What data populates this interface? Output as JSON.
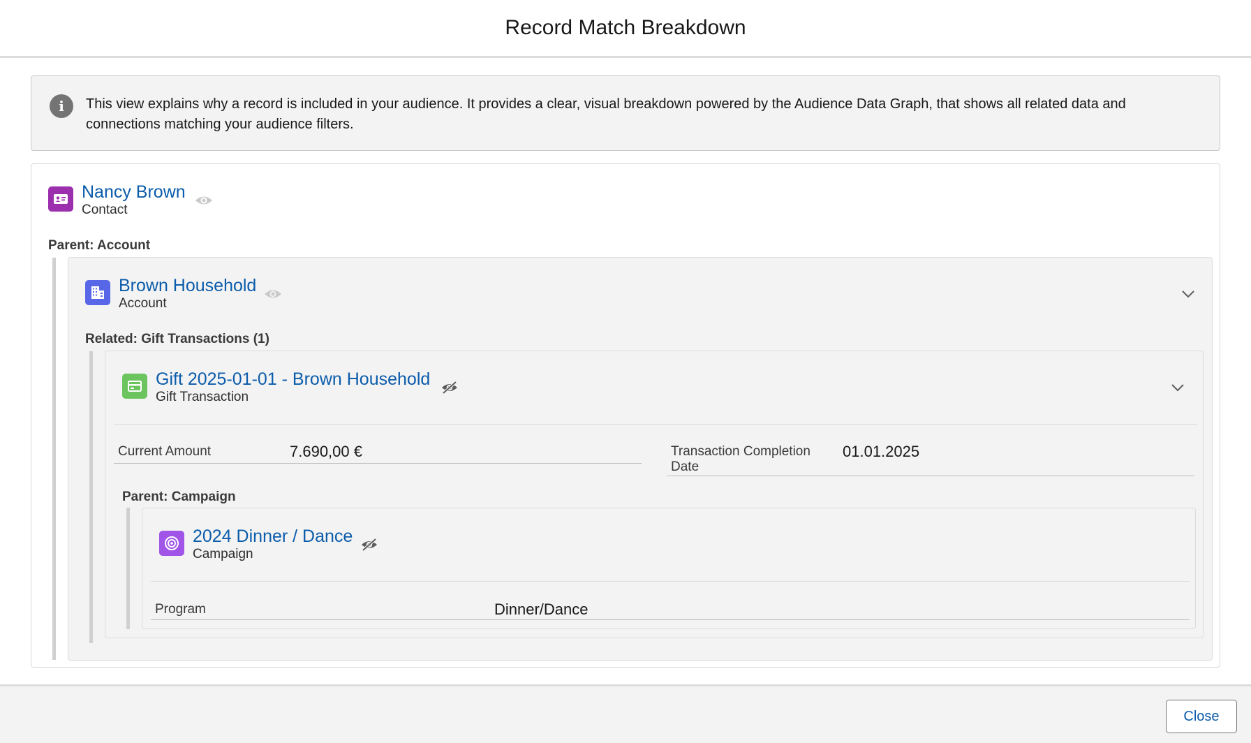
{
  "modal": {
    "title": "Record Match Breakdown",
    "info_text": "This view explains why a record is included in your audience. It provides a clear, visual breakdown powered by the Audience Data Graph, that shows all related data and connections matching your audience filters.",
    "close_label": "Close"
  },
  "contact": {
    "name": "Nancy Brown",
    "type": "Contact",
    "icon": "contact-card-icon",
    "color": "#9b2fae"
  },
  "account": {
    "section_label": "Parent: Account",
    "name": "Brown Household",
    "type": "Account",
    "icon": "building-icon",
    "color": "#5867e8"
  },
  "gift": {
    "section_label": "Related: Gift Transactions (1)",
    "name": "Gift 2025-01-01 - Brown Household",
    "type": "Gift Transaction",
    "icon": "credit-card-icon",
    "color": "#6cc45f",
    "fields": {
      "amount_label": "Current Amount",
      "amount_value": "7.690,00 €",
      "date_label": "Transaction Completion Date",
      "date_value": "01.01.2025"
    }
  },
  "campaign": {
    "section_label": "Parent: Campaign",
    "name": "2024 Dinner / Dance",
    "type": "Campaign",
    "icon": "target-icon",
    "color": "#a055e8",
    "fields": {
      "program_label": "Program",
      "program_value": "Dinner/Dance"
    }
  }
}
